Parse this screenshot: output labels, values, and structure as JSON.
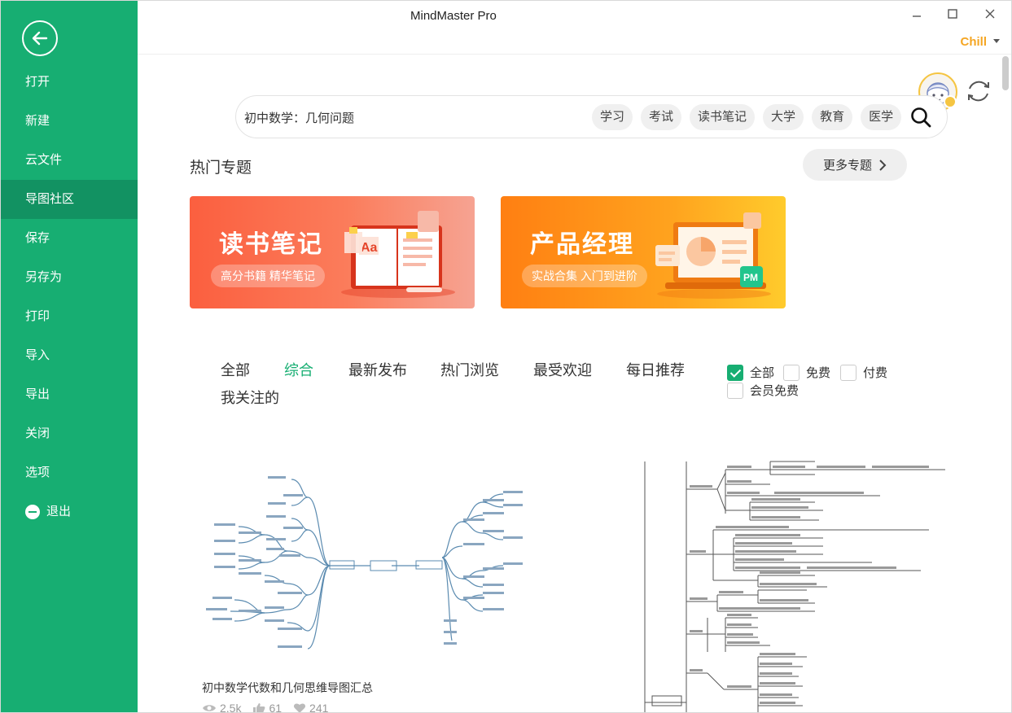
{
  "app": {
    "title": "MindMaster Pro",
    "user": "Chill"
  },
  "sidebar": {
    "items": [
      {
        "label": "打开",
        "id": "open"
      },
      {
        "label": "新建",
        "id": "new"
      },
      {
        "label": "云文件",
        "id": "cloud"
      },
      {
        "label": "导图社区",
        "id": "community",
        "active": true
      },
      {
        "label": "保存",
        "id": "save"
      },
      {
        "label": "另存为",
        "id": "save-as"
      },
      {
        "label": "打印",
        "id": "print"
      },
      {
        "label": "导入",
        "id": "import"
      },
      {
        "label": "导出",
        "id": "export"
      },
      {
        "label": "关闭",
        "id": "close"
      },
      {
        "label": "选项",
        "id": "options"
      },
      {
        "label": "退出",
        "id": "exit"
      }
    ]
  },
  "search": {
    "value": "初中数学：几何问题",
    "tags": [
      "学习",
      "考试",
      "读书笔记",
      "大学",
      "教育",
      "医学"
    ]
  },
  "hot": {
    "title": "热门专题",
    "more_label": "更多专题",
    "banners": [
      {
        "title": "读书笔记",
        "subtitle": "高分书籍 精华笔记"
      },
      {
        "title": "产品经理",
        "subtitle": "实战合集 入门到进阶"
      }
    ]
  },
  "tabs": [
    "全部",
    "综合",
    "最新发布",
    "热门浏览",
    "最受欢迎",
    "每日推荐",
    "我关注的"
  ],
  "active_tab": "综合",
  "filters": [
    {
      "label": "全部",
      "checked": true
    },
    {
      "label": "免费",
      "checked": false
    },
    {
      "label": "付费",
      "checked": false
    },
    {
      "label": "会员免费",
      "checked": false
    }
  ],
  "cards": [
    {
      "title": "初中数学代数和几何思维导图汇总",
      "views": "2.5k",
      "likes": "61",
      "favorites": "241"
    }
  ],
  "colors": {
    "brand": "#17ae72",
    "brand_dark": "#129262",
    "user": "#f5a623"
  }
}
